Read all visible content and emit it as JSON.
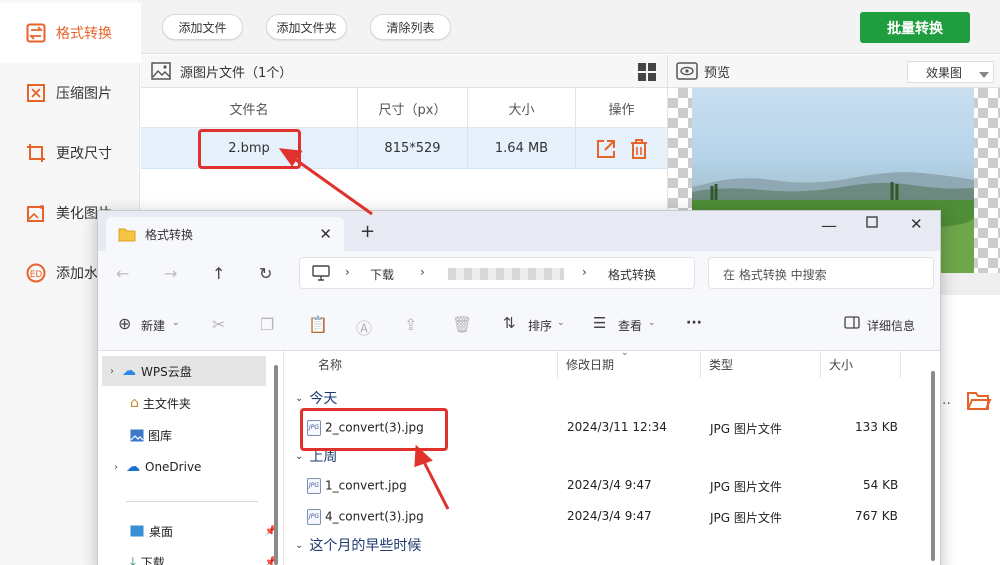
{
  "sidebar": {
    "items": [
      {
        "label": "格式转换",
        "icon": "format-convert-icon",
        "active": true
      },
      {
        "label": "压缩图片",
        "icon": "compress-icon"
      },
      {
        "label": "更改尺寸",
        "icon": "resize-icon"
      },
      {
        "label": "美化图片",
        "icon": "beautify-icon"
      },
      {
        "label": "添加水印",
        "icon": "watermark-icon"
      }
    ]
  },
  "toolbar": {
    "add_file": "添加文件",
    "add_folder": "添加文件夹",
    "clear_list": "清除列表",
    "batch_convert": "批量转换",
    "accent": "#1f9d3f"
  },
  "source": {
    "title": "源图片文件（1个）",
    "columns": [
      "文件名",
      "尺寸（px）",
      "大小",
      "操作"
    ],
    "rows": [
      {
        "name": "2.bmp",
        "size_px": "815*529",
        "size": "1.64 MB"
      }
    ]
  },
  "preview": {
    "title": "预览",
    "mode": "效果图"
  },
  "explorer": {
    "tab_title": "格式转换",
    "breadcrumb": [
      "下载",
      "格式转换"
    ],
    "search_placeholder": "在 格式转换 中搜索",
    "commands": {
      "new": "新建",
      "sort": "排序",
      "view": "查看",
      "more": "···",
      "details": "详细信息"
    },
    "nav": [
      {
        "label": "WPS云盘",
        "icon": "cloud-icon",
        "expandable": true,
        "selected": true
      },
      {
        "label": "主文件夹",
        "icon": "home-icon"
      },
      {
        "label": "图库",
        "icon": "gallery-icon"
      },
      {
        "label": "OneDrive",
        "icon": "onedrive-icon",
        "expandable": true
      },
      {
        "label": "桌面",
        "icon": "desktop-icon"
      },
      {
        "label": "下载",
        "icon": "download-icon"
      }
    ],
    "columns": [
      "名称",
      "修改日期",
      "类型",
      "大小"
    ],
    "groups": [
      {
        "name": "今天",
        "files": [
          {
            "name": "2_convert(3).jpg",
            "date": "2024/3/11 12:34",
            "type": "JPG 图片文件",
            "size": "133 KB"
          }
        ]
      },
      {
        "name": "上周",
        "files": [
          {
            "name": "1_convert.jpg",
            "date": "2024/3/4 9:47",
            "type": "JPG 图片文件",
            "size": "54 KB"
          },
          {
            "name": "4_convert(3).jpg",
            "date": "2024/3/4 9:47",
            "type": "JPG 图片文件",
            "size": "767 KB"
          }
        ]
      },
      {
        "name": "这个月的早些时候",
        "files": []
      }
    ]
  },
  "annotation_color": "#e0312c"
}
